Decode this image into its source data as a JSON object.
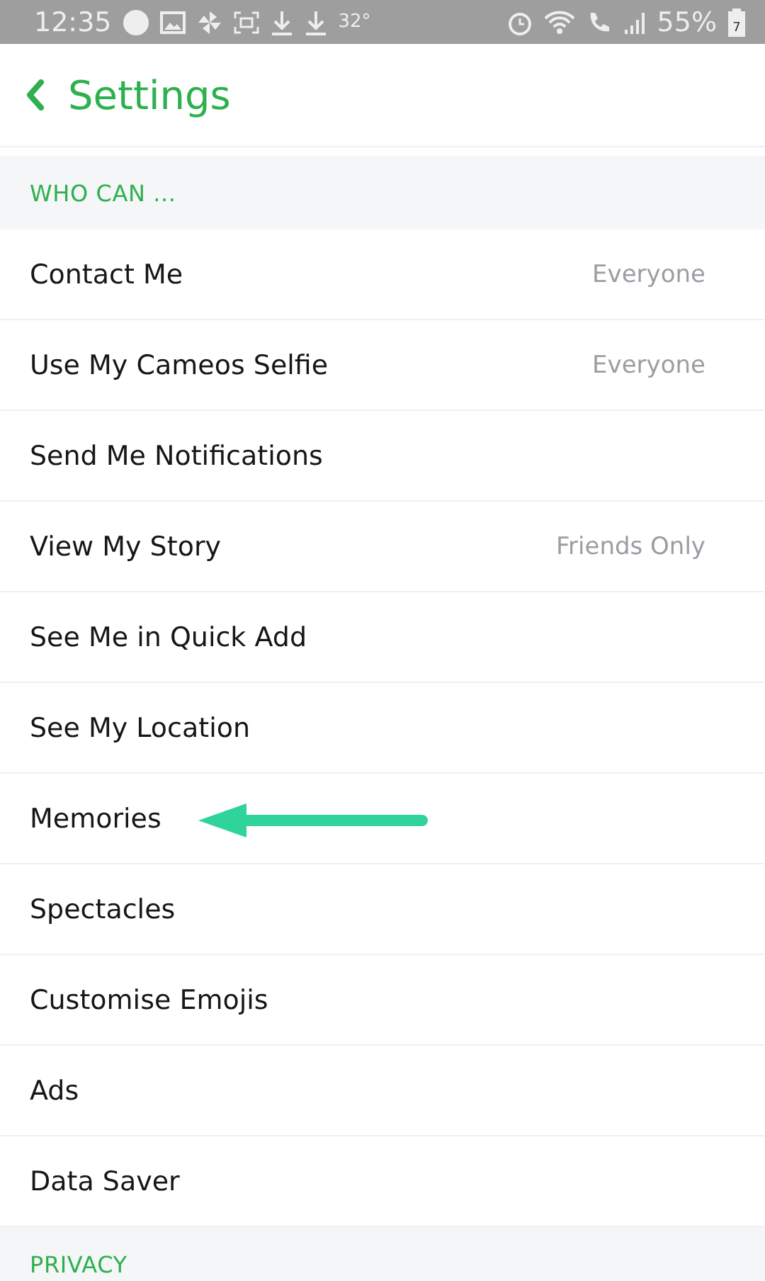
{
  "status_bar": {
    "time": "12:35",
    "temperature": "32°",
    "battery": "55%",
    "battery_digit": "7"
  },
  "header": {
    "title": "Settings"
  },
  "sections": [
    {
      "title": "WHO CAN ...",
      "items": [
        {
          "label": "Contact Me",
          "value": "Everyone"
        },
        {
          "label": "Use My Cameos Selfie",
          "value": "Everyone"
        },
        {
          "label": "Send Me Notifications"
        },
        {
          "label": "View My Story",
          "value": "Friends Only"
        },
        {
          "label": "See Me in Quick Add"
        },
        {
          "label": "See My Location"
        },
        {
          "label": "Memories",
          "highlighted": true
        },
        {
          "label": "Spectacles"
        },
        {
          "label": "Customise Emojis"
        },
        {
          "label": "Ads"
        },
        {
          "label": "Data Saver"
        }
      ]
    },
    {
      "title": "PRIVACY"
    }
  ]
}
